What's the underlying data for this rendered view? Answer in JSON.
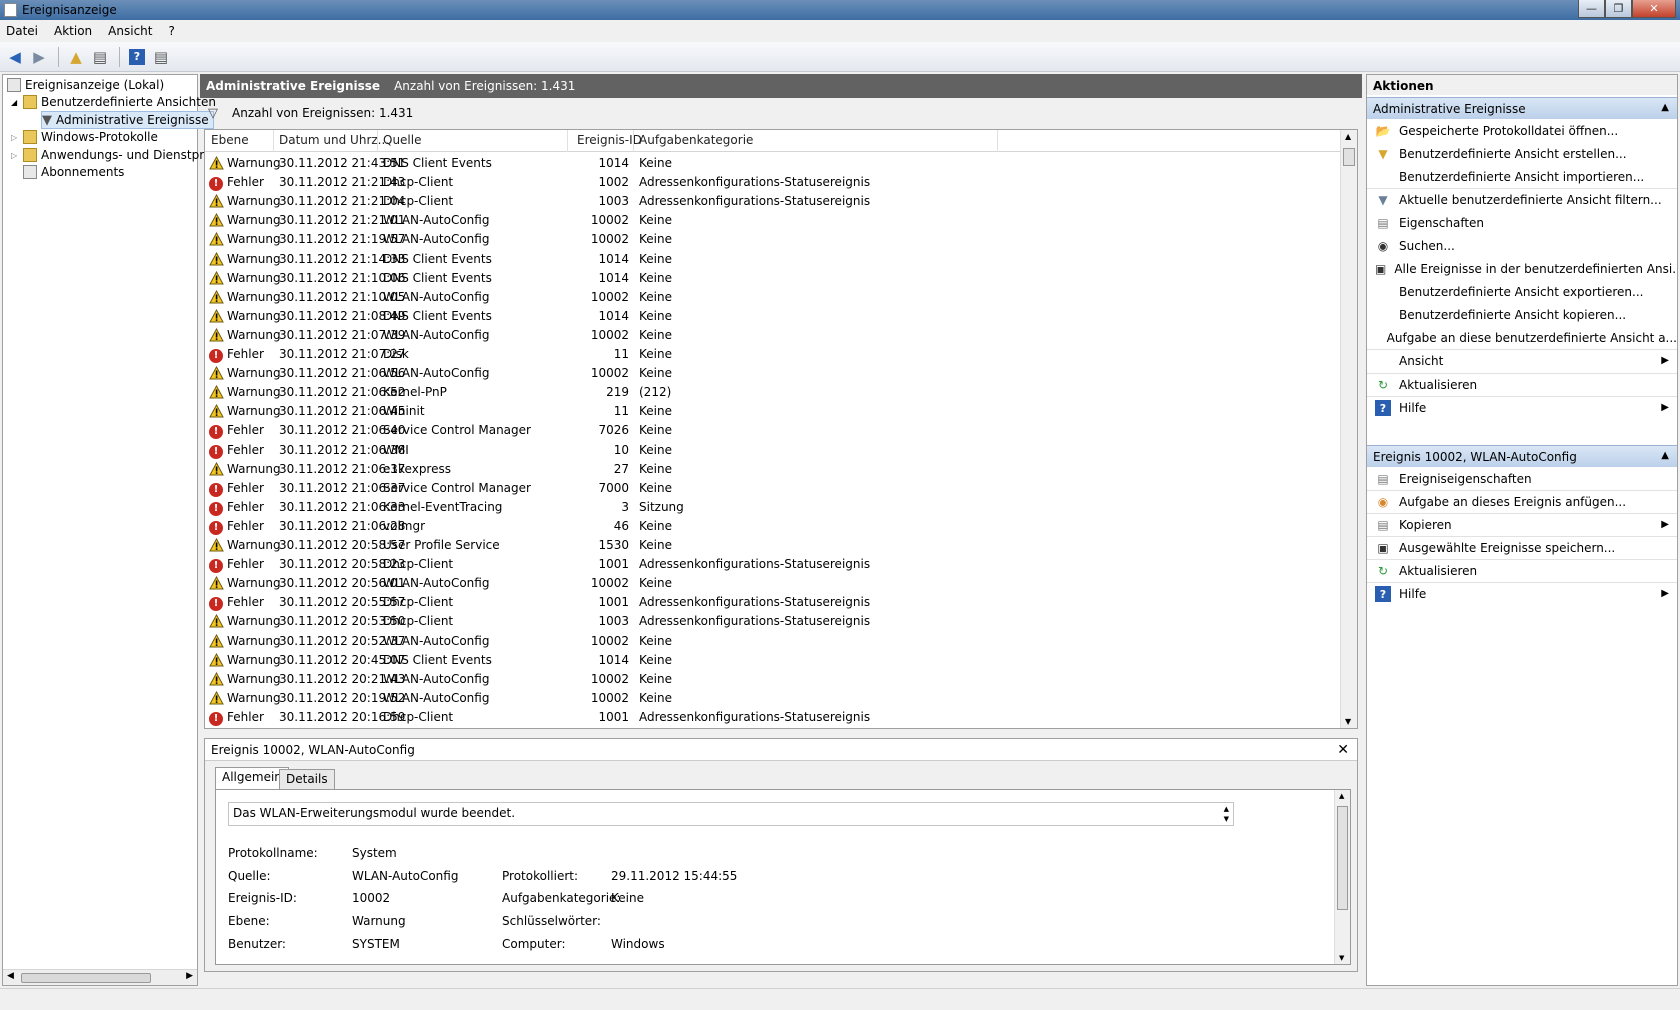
{
  "window": {
    "title": "Ereignisanzeige"
  },
  "menu": [
    "Datei",
    "Aktion",
    "Ansicht",
    "?"
  ],
  "tree": [
    {
      "label": "Ereignisanzeige (Lokal)"
    },
    {
      "label": "Benutzerdefinierte Ansichten"
    },
    {
      "label": "Administrative Ereignisse"
    },
    {
      "label": "Windows-Protokolle"
    },
    {
      "label": "Anwendungs- und Dienstprotokolle"
    },
    {
      "label": "Abonnements"
    }
  ],
  "center": {
    "header_title": "Administrative Ereignisse",
    "header_count": "Anzahl von Ereignissen: 1.431",
    "filter_text": "Anzahl von Ereignissen: 1.431"
  },
  "columns": [
    "Ebene",
    "Datum und Uhrz...",
    "Quelle",
    "Ereignis-ID",
    "Aufgabenkategorie"
  ],
  "rows": [
    {
      "level": "Warnung",
      "date": "30.11.2012 21:43:51",
      "source": "DNS Client Events",
      "id": "1014",
      "cat": "Keine"
    },
    {
      "level": "Fehler",
      "date": "30.11.2012 21:21:43",
      "source": "Dhcp-Client",
      "id": "1002",
      "cat": "Adressenkonfigurations-Statusereignis"
    },
    {
      "level": "Warnung",
      "date": "30.11.2012 21:21:04",
      "source": "Dhcp-Client",
      "id": "1003",
      "cat": "Adressenkonfigurations-Statusereignis"
    },
    {
      "level": "Warnung",
      "date": "30.11.2012 21:21:01",
      "source": "WLAN-AutoConfig",
      "id": "10002",
      "cat": "Keine"
    },
    {
      "level": "Warnung",
      "date": "30.11.2012 21:19:57",
      "source": "WLAN-AutoConfig",
      "id": "10002",
      "cat": "Keine"
    },
    {
      "level": "Warnung",
      "date": "30.11.2012 21:14:33",
      "source": "DNS Client Events",
      "id": "1014",
      "cat": "Keine"
    },
    {
      "level": "Warnung",
      "date": "30.11.2012 21:10:06",
      "source": "DNS Client Events",
      "id": "1014",
      "cat": "Keine"
    },
    {
      "level": "Warnung",
      "date": "30.11.2012 21:10:05",
      "source": "WLAN-AutoConfig",
      "id": "10002",
      "cat": "Keine"
    },
    {
      "level": "Warnung",
      "date": "30.11.2012 21:08:49",
      "source": "DNS Client Events",
      "id": "1014",
      "cat": "Keine"
    },
    {
      "level": "Warnung",
      "date": "30.11.2012 21:07:39",
      "source": "WLAN-AutoConfig",
      "id": "10002",
      "cat": "Keine"
    },
    {
      "level": "Fehler",
      "date": "30.11.2012 21:07:27",
      "source": "Disk",
      "id": "11",
      "cat": "Keine"
    },
    {
      "level": "Warnung",
      "date": "30.11.2012 21:06:56",
      "source": "WLAN-AutoConfig",
      "id": "10002",
      "cat": "Keine"
    },
    {
      "level": "Warnung",
      "date": "30.11.2012 21:06:52",
      "source": "Kernel-PnP",
      "id": "219",
      "cat": "(212)"
    },
    {
      "level": "Warnung",
      "date": "30.11.2012 21:06:45",
      "source": "Wininit",
      "id": "11",
      "cat": "Keine"
    },
    {
      "level": "Fehler",
      "date": "30.11.2012 21:06:40",
      "source": "Service Control Manager",
      "id": "7026",
      "cat": "Keine"
    },
    {
      "level": "Fehler",
      "date": "30.11.2012 21:06:38",
      "source": "WMI",
      "id": "10",
      "cat": "Keine"
    },
    {
      "level": "Warnung",
      "date": "30.11.2012 21:06:37",
      "source": "e1kexpress",
      "id": "27",
      "cat": "Keine"
    },
    {
      "level": "Fehler",
      "date": "30.11.2012 21:06:37",
      "source": "Service Control Manager",
      "id": "7000",
      "cat": "Keine"
    },
    {
      "level": "Fehler",
      "date": "30.11.2012 21:06:33",
      "source": "Kernel-EventTracing",
      "id": "3",
      "cat": "Sitzung"
    },
    {
      "level": "Fehler",
      "date": "30.11.2012 21:06:28",
      "source": "volmgr",
      "id": "46",
      "cat": "Keine"
    },
    {
      "level": "Warnung",
      "date": "30.11.2012 20:58:57",
      "source": "User Profile Service",
      "id": "1530",
      "cat": "Keine"
    },
    {
      "level": "Fehler",
      "date": "30.11.2012 20:58:23",
      "source": "Dhcp-Client",
      "id": "1001",
      "cat": "Adressenkonfigurations-Statusereignis"
    },
    {
      "level": "Warnung",
      "date": "30.11.2012 20:56:01",
      "source": "WLAN-AutoConfig",
      "id": "10002",
      "cat": "Keine"
    },
    {
      "level": "Fehler",
      "date": "30.11.2012 20:55:57",
      "source": "Dhcp-Client",
      "id": "1001",
      "cat": "Adressenkonfigurations-Statusereignis"
    },
    {
      "level": "Warnung",
      "date": "30.11.2012 20:53:50",
      "source": "Dhcp-Client",
      "id": "1003",
      "cat": "Adressenkonfigurations-Statusereignis"
    },
    {
      "level": "Warnung",
      "date": "30.11.2012 20:52:37",
      "source": "WLAN-AutoConfig",
      "id": "10002",
      "cat": "Keine"
    },
    {
      "level": "Warnung",
      "date": "30.11.2012 20:45:07",
      "source": "DNS Client Events",
      "id": "1014",
      "cat": "Keine"
    },
    {
      "level": "Warnung",
      "date": "30.11.2012 20:21:43",
      "source": "WLAN-AutoConfig",
      "id": "10002",
      "cat": "Keine"
    },
    {
      "level": "Warnung",
      "date": "30.11.2012 20:19:52",
      "source": "WLAN-AutoConfig",
      "id": "10002",
      "cat": "Keine"
    },
    {
      "level": "Fehler",
      "date": "30.11.2012 20:16:59",
      "source": "Dhcp-Client",
      "id": "1001",
      "cat": "Adressenkonfigurations-Statusereignis"
    }
  ],
  "detail": {
    "title": "Ereignis 10002, WLAN-AutoConfig",
    "tabs": [
      "Allgemein",
      "Details"
    ],
    "message": "Das WLAN-Erweiterungsmodul wurde beendet.",
    "fields": {
      "protokollname_label": "Protokollname:",
      "protokollname": "System",
      "quelle_label": "Quelle:",
      "quelle": "WLAN-AutoConfig",
      "protokolliert_label": "Protokolliert:",
      "protokolliert": "29.11.2012 15:44:55",
      "ereignisid_label": "Ereignis-ID:",
      "ereignisid": "10002",
      "aufgabenkategorie_label": "Aufgabenkategorie:",
      "aufgabenkategorie": "Keine",
      "ebene_label": "Ebene:",
      "ebene": "Warnung",
      "schluesselwoerter_label": "Schlüsselwörter:",
      "benutzer_label": "Benutzer:",
      "benutzer": "SYSTEM",
      "computer_label": "Computer:",
      "computer": "Windows"
    }
  },
  "actions": {
    "title": "Aktionen",
    "section1": "Administrative Ereignisse",
    "items1": [
      "Gespeicherte Protokolldatei öffnen...",
      "Benutzerdefinierte Ansicht erstellen...",
      "Benutzerdefinierte Ansicht importieren...",
      "Aktuelle benutzerdefinierte Ansicht filtern...",
      "Eigenschaften",
      "Suchen...",
      "Alle Ereignisse in der benutzerdefinierten Ansi...",
      "Benutzerdefinierte Ansicht exportieren...",
      "Benutzerdefinierte Ansicht kopieren...",
      "Aufgabe an diese benutzerdefinierte Ansicht a...",
      "Ansicht",
      "Aktualisieren",
      "Hilfe"
    ],
    "section2": "Ereignis 10002, WLAN-AutoConfig",
    "items2": [
      "Ereigniseigenschaften",
      "Aufgabe an dieses Ereignis anfügen...",
      "Kopieren",
      "Ausgewählte Ereignisse speichern...",
      "Aktualisieren",
      "Hilfe"
    ]
  }
}
